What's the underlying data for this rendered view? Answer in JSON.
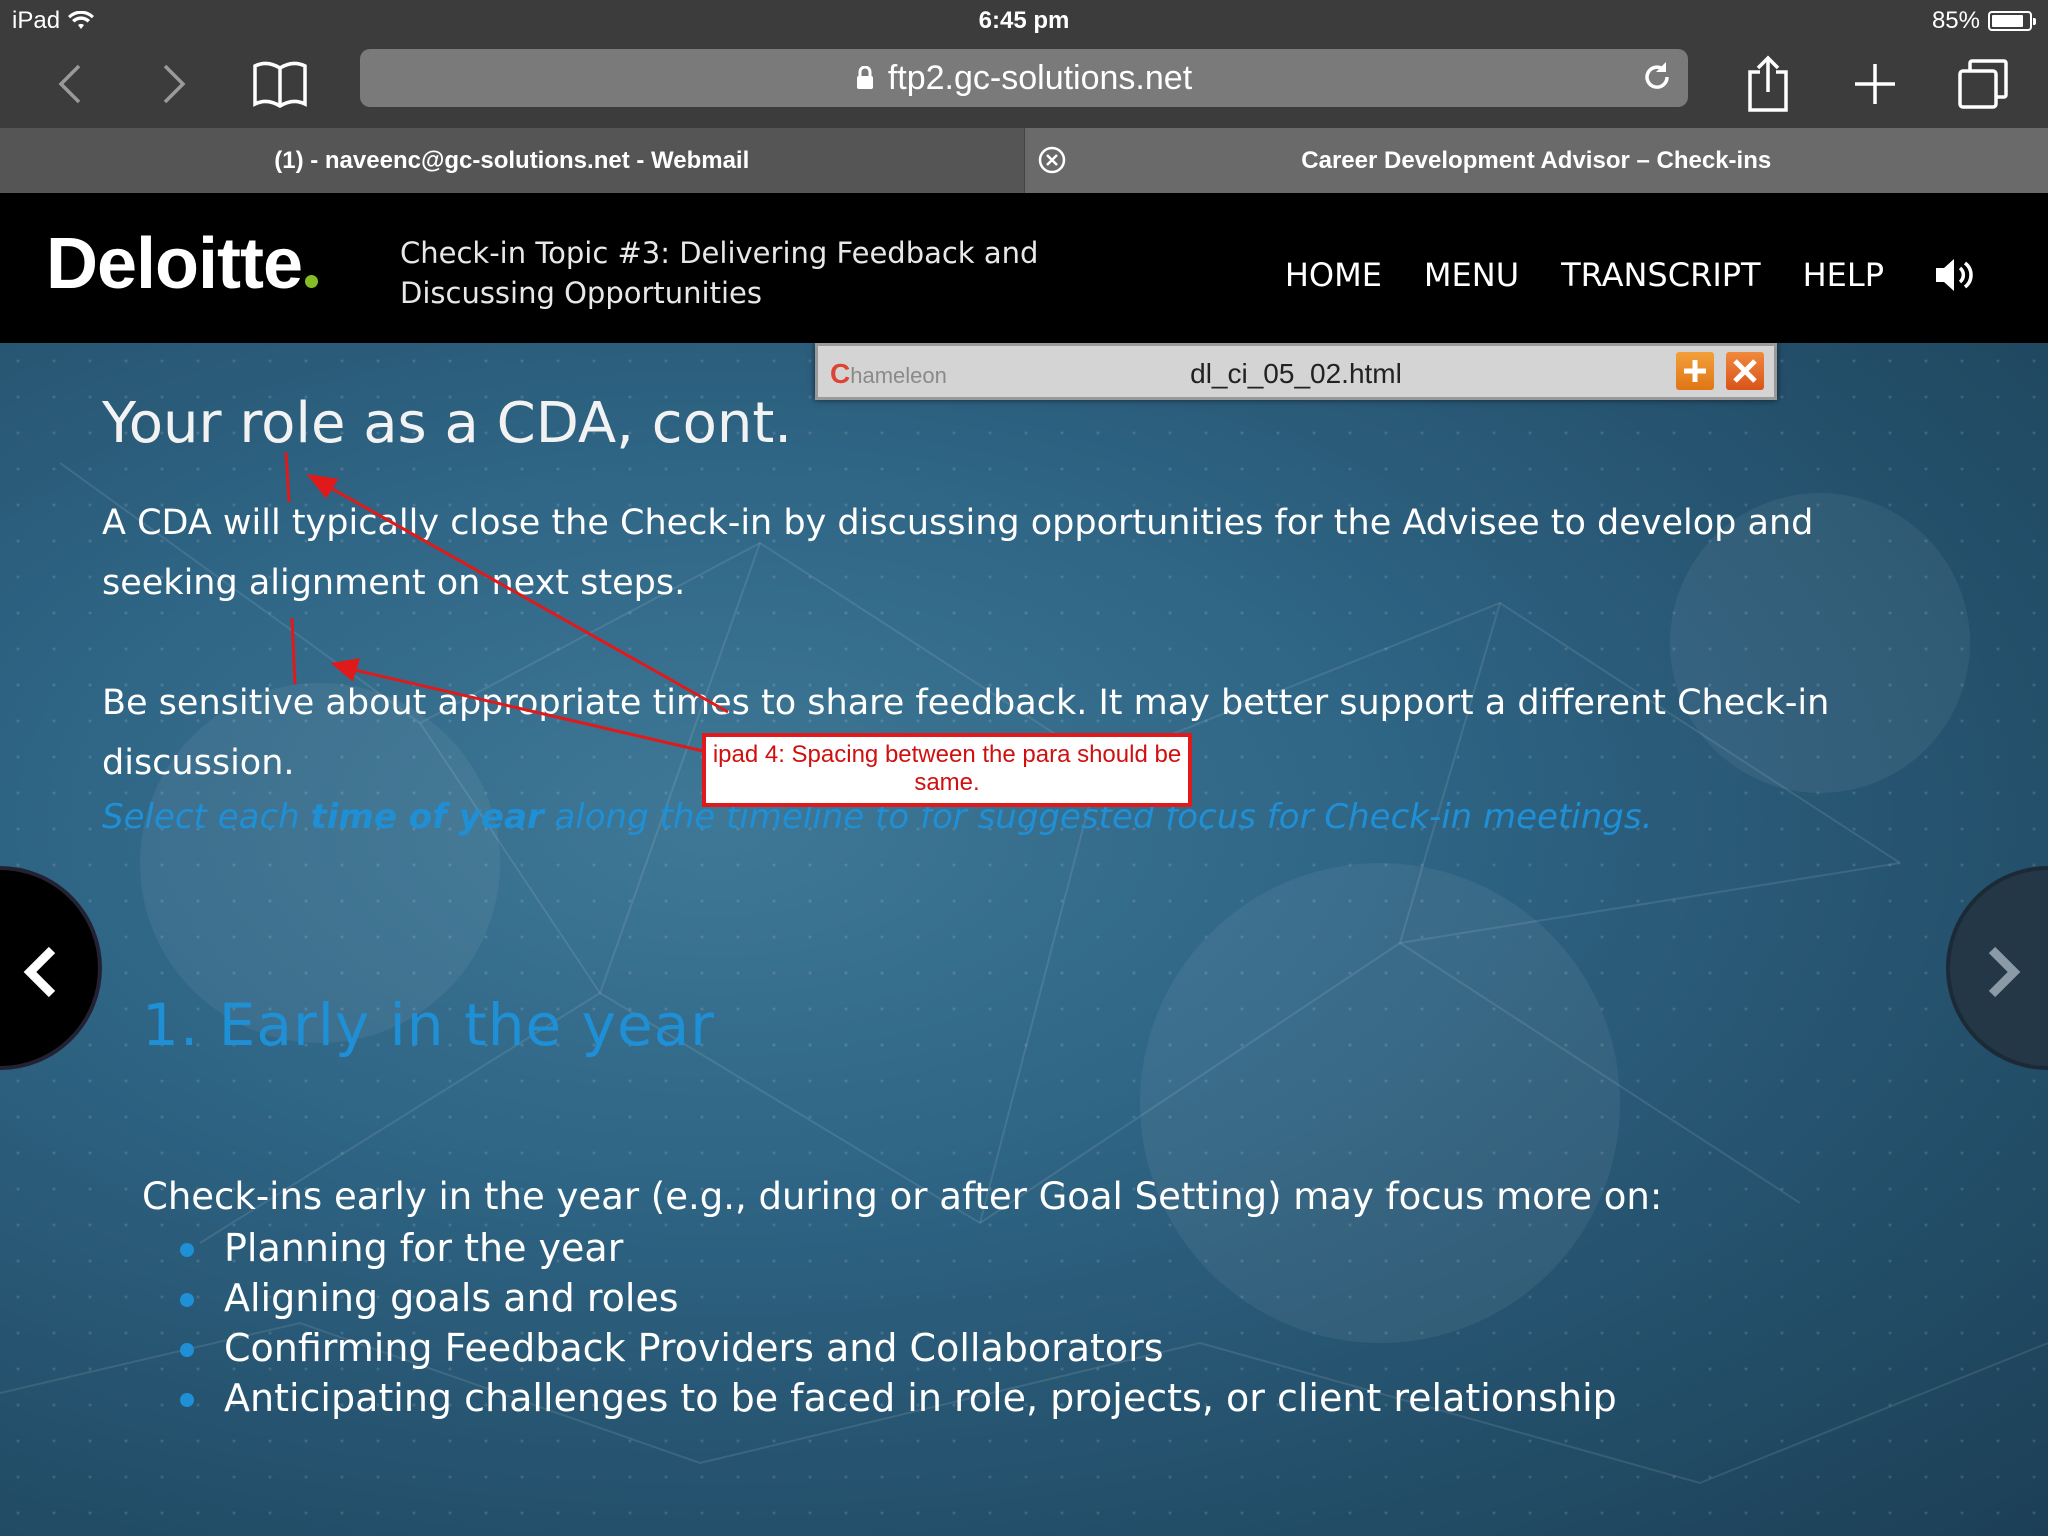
{
  "status_bar": {
    "device": "iPad",
    "time": "6:45 pm",
    "battery_text": "85%",
    "battery_level": 0.85
  },
  "browser": {
    "url": "ftp2.gc-solutions.net",
    "tabs": [
      {
        "title": "(1) - naveenc@gc-solutions.net - Webmail",
        "active": false
      },
      {
        "title": "Career Development Advisor – Check-ins",
        "active": true
      }
    ]
  },
  "course": {
    "logo": "Deloitte",
    "logo_dot_color": "#86bc25",
    "topic_title": "Check-in Topic #3: Delivering Feedback and Discussing Opportunities",
    "nav": [
      "HOME",
      "MENU",
      "TRANSCRIPT",
      "HELP"
    ]
  },
  "slide": {
    "title": "Your role as a CDA, cont.",
    "para1": "A CDA will typically close the Check-in by discussing opportunities for the Advisee to develop and seeking alignment on next steps.",
    "para2": "Be sensitive about appropriate times to share feedback. It may better support a different Check-in discussion.",
    "instruction_pre": "Select each ",
    "instruction_bold": "time of year",
    "instruction_post": " along the timeline to for suggested focus for Check-in meetings.",
    "section_heading": "1. Early in the year",
    "section_intro": "Check-ins early in the year (e.g., during or after Goal Setting) may focus more on:",
    "focus_items": [
      "Planning for the year",
      "Aligning goals and roles",
      "Confirming Feedback Providers and Collaborators",
      "Anticipating challenges to be faced in role, projects, or client relationship"
    ],
    "accent_color": "#1f8fd6"
  },
  "chameleon": {
    "logo": "hameleon",
    "file": "dl_ci_05_02.html"
  },
  "review": {
    "note": "ipad 4: Spacing between the para should be same."
  }
}
